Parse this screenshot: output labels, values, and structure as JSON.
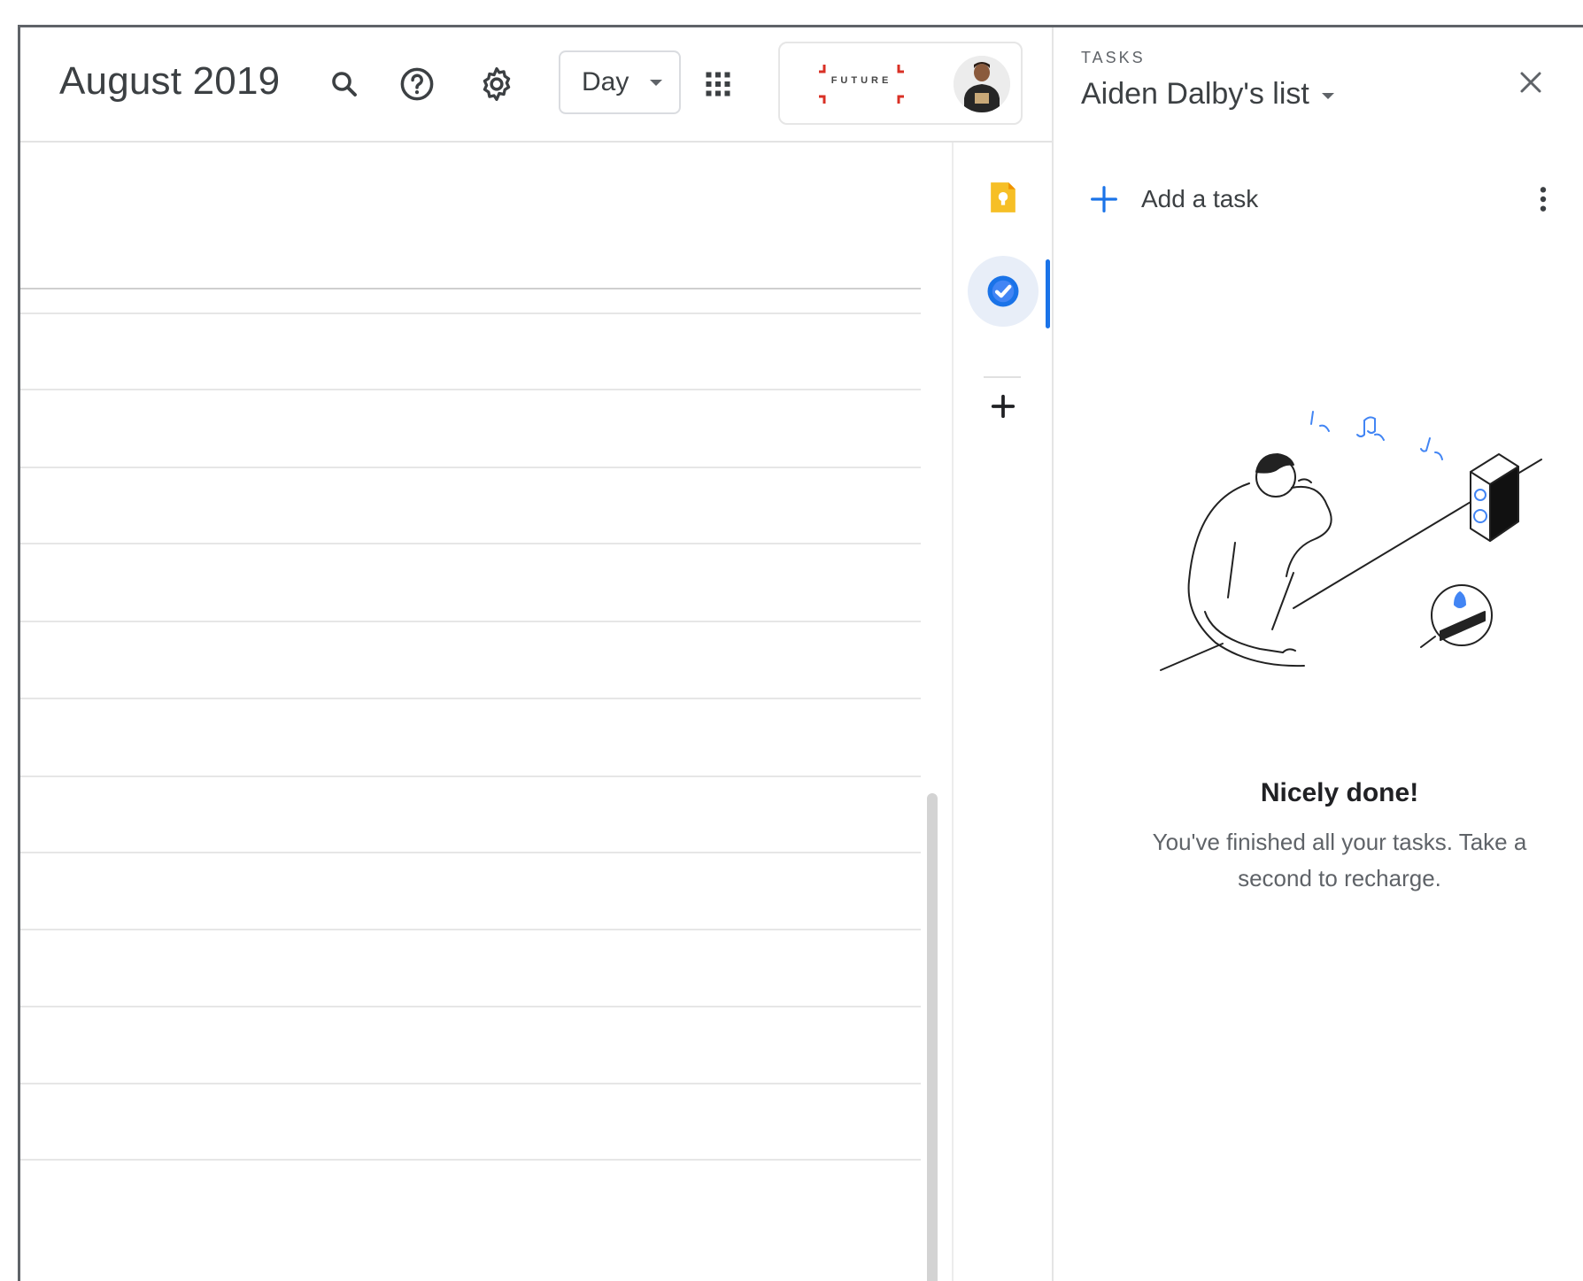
{
  "calendar": {
    "title": "August 2019",
    "view_selector": {
      "selected": "Day"
    }
  },
  "header_icons": [
    "search-icon",
    "help-icon",
    "settings-icon",
    "apps-grid-icon"
  ],
  "account": {
    "brand_text": "FUTURE"
  },
  "side_rail": {
    "items": [
      "keep-icon",
      "tasks-icon",
      "add-icon"
    ],
    "active": "tasks"
  },
  "tasks": {
    "eyebrow": "TASKS",
    "list_name": "Aiden Dalby's list",
    "add_task_label": "Add a task",
    "empty_title": "Nicely done!",
    "empty_message": "You've finished all your tasks. Take a second to recharge."
  },
  "colors": {
    "accent_blue": "#1a73e8",
    "keep_yellow": "#f6bf26",
    "brand_red": "#d93025"
  }
}
